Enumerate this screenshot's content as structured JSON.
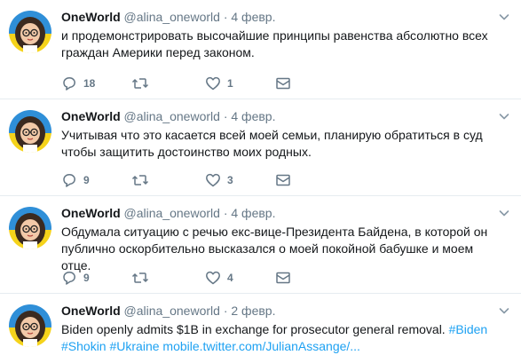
{
  "colors": {
    "text": "#14171a",
    "muted": "#657786",
    "link": "#1da1f2",
    "divider": "#e6ecf0"
  },
  "icons": {
    "reply": "reply-icon",
    "retweet": "retweet-icon",
    "like": "heart-icon",
    "dm": "envelope-icon",
    "more": "chevron-down-icon"
  },
  "tweets": [
    {
      "name": "OneWorld",
      "handle": "@alina_oneworld",
      "sep": "·",
      "date": "4 февр.",
      "text": "и продемонстрировать высочайшие принципы равенства абсолютно всех граждан Америки перед законом.",
      "replies": "18",
      "retweets": "",
      "likes": "1"
    },
    {
      "name": "OneWorld",
      "handle": "@alina_oneworld",
      "sep": "·",
      "date": "4 февр.",
      "text": "Учитывая что это касается всей моей семьи, планирую обратиться в суд чтобы защитить достоинство моих родных.",
      "replies": "9",
      "retweets": "",
      "likes": "3"
    },
    {
      "name": "OneWorld",
      "handle": "@alina_oneworld",
      "sep": "·",
      "date": "4 февр.",
      "text": "Обдумала ситуацию с речью екс-вице-Президента Байдена, в которой он публично оскорбительно высказался о моей покойной бабушке и моем отце.",
      "replies": "9",
      "retweets": "",
      "likes": "4"
    },
    {
      "name": "OneWorld",
      "handle": "@alina_oneworld",
      "sep": "·",
      "date": "2 февр.",
      "text_plain": "Biden openly admits $1B in exchange for prosecutor general removal. ",
      "tag_biden": "#Biden",
      "tag_shokin": "#Shokin",
      "tag_ukraine": "#Ukraine",
      "link": "mobile.twitter.com/JulianAssange/..."
    }
  ]
}
